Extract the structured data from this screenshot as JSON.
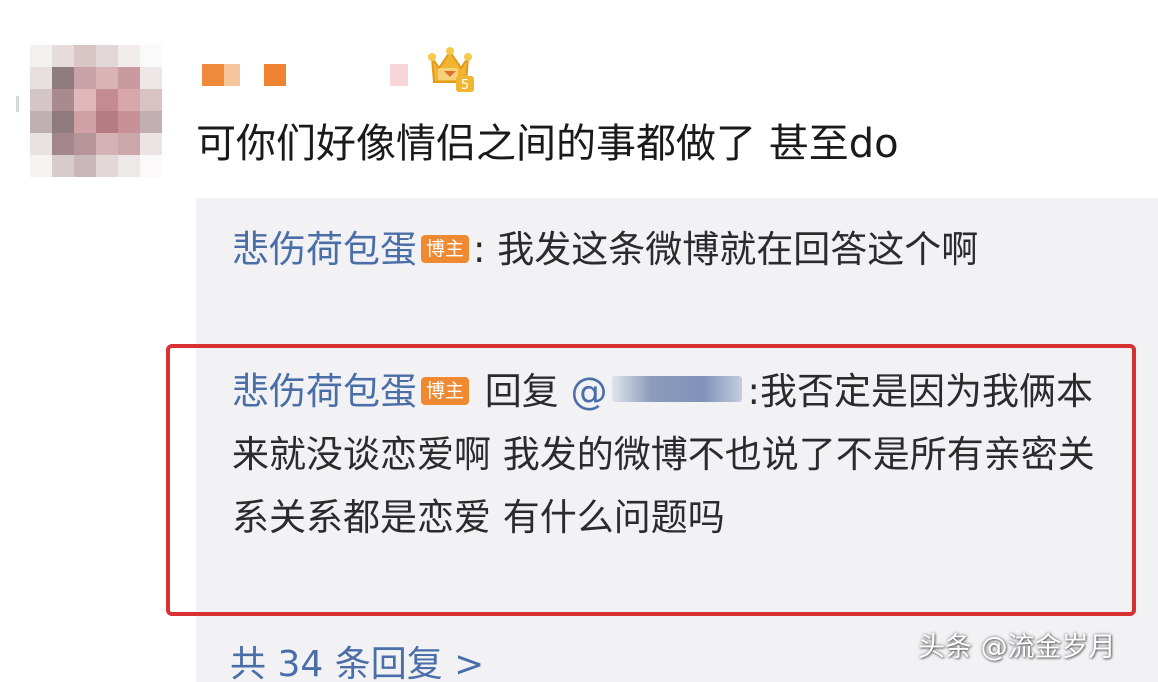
{
  "comment": {
    "text": "可你们好像情侣之间的事都做了 甚至do",
    "level_badge": "5"
  },
  "replies": [
    {
      "author": "悲伤荷包蛋",
      "badge": "博主",
      "separator": ":",
      "text": "我发这条微博就在回答这个啊"
    },
    {
      "author": "悲伤荷包蛋",
      "badge": "博主",
      "reply_word": "回复",
      "mention_prefix": "@",
      "separator": ":",
      "text": "我否定是因为我俩本来就没谈恋爱啊 我发的微博不也说了不是所有亲密关系关系都是恋爱 有什么问题吗"
    }
  ],
  "total_replies": "共 34 条回复 >",
  "watermark": "头条 @流金岁月",
  "colors": {
    "author_link": "#4a6ea8",
    "badge_bg": "#f08a32",
    "highlight_border": "#d73131",
    "reply_bg": "#f2f2f4"
  }
}
